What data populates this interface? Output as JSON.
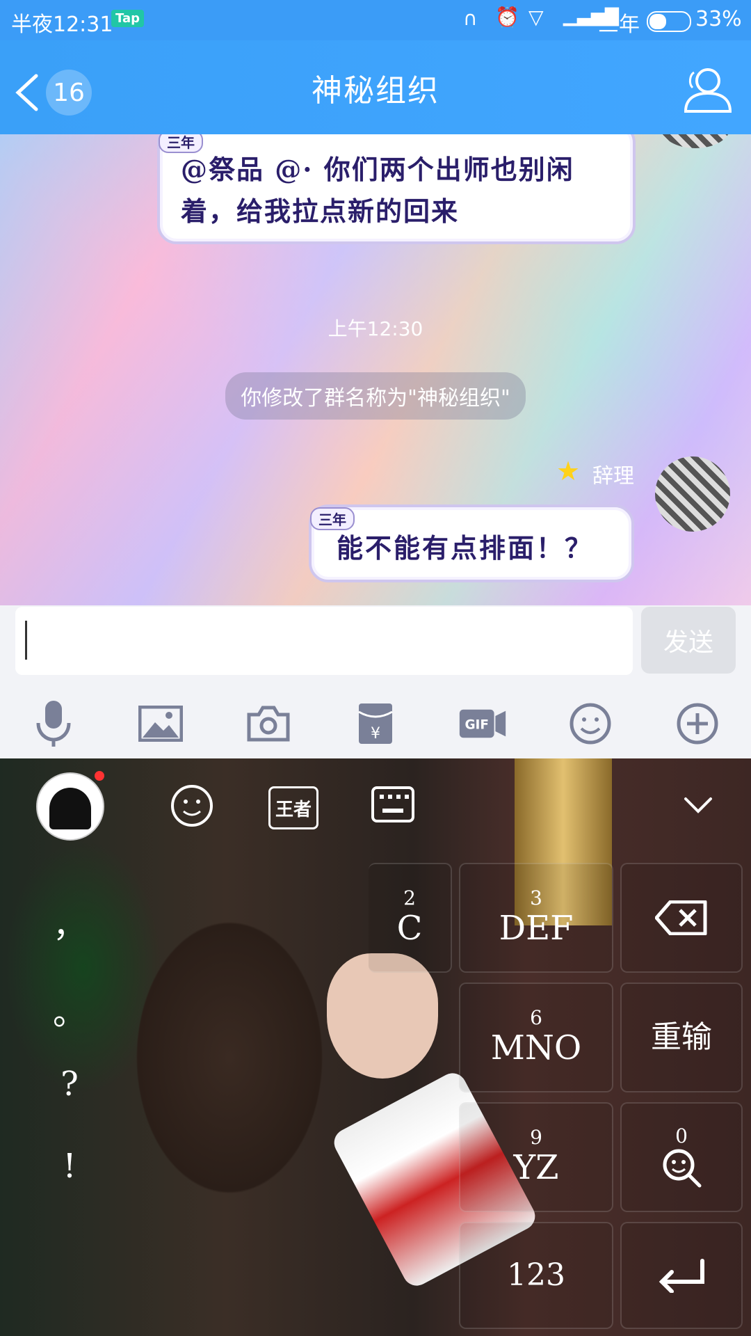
{
  "status_bar": {
    "time": "半夜12:31",
    "app_tag": "Tap",
    "carrier": "三年",
    "battery": "33%"
  },
  "header": {
    "back_count": "16",
    "title": "神秘组织"
  },
  "chat": {
    "messages": [
      {
        "tag": "三年",
        "text_line1": "@祭品 @· 你们两个出师也别闲",
        "text_line2": "着，给我拉点新的回来"
      }
    ],
    "timestamp": "上午12:30",
    "system_message": "你修改了群名称为\"神秘组织\"",
    "reply": {
      "sender": "辞理",
      "tag": "三年",
      "text": "能不能有点排面！？"
    }
  },
  "input": {
    "value": "",
    "send_label": "发送"
  },
  "toolbar": {
    "icons": [
      "microphone-icon",
      "image-icon",
      "camera-icon",
      "red-packet-icon",
      "gif-icon",
      "emoji-icon",
      "plus-icon"
    ]
  },
  "keyboard": {
    "top_icons": [
      "avatar",
      "emoji-icon",
      "wangzhe-icon",
      "keyboard-icon",
      "collapse-chevron-icon"
    ],
    "symbols": [
      "，",
      "。",
      "?",
      "!"
    ],
    "keys": [
      {
        "num": "2",
        "letters": "C"
      },
      {
        "num": "3",
        "letters": "DEF"
      },
      {
        "num": "6",
        "letters": "MNO"
      },
      {
        "num": "9",
        "letters": "YZ"
      },
      {
        "num": "0",
        "letters": ""
      }
    ],
    "reenter_label": "重输",
    "num_label": "123"
  }
}
